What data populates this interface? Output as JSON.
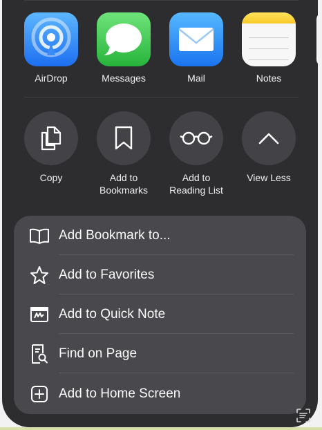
{
  "apps": [
    {
      "name": "airdrop",
      "label": "AirDrop",
      "icon": "airdrop-icon"
    },
    {
      "name": "messages",
      "label": "Messages",
      "icon": "messages-icon"
    },
    {
      "name": "mail",
      "label": "Mail",
      "icon": "mail-icon"
    },
    {
      "name": "notes",
      "label": "Notes",
      "icon": "notes-icon"
    }
  ],
  "actions": [
    {
      "line1": "Copy",
      "line2": "",
      "icon": "copy-icon"
    },
    {
      "line1": "Add to",
      "line2": "Bookmarks",
      "icon": "bookmark-icon"
    },
    {
      "line1": "Add to",
      "line2": "Reading List",
      "icon": "glasses-icon"
    },
    {
      "line1": "View Less",
      "line2": "",
      "icon": "chevron-up-icon"
    }
  ],
  "menu": [
    {
      "label": "Add Bookmark to...",
      "icon": "book-icon"
    },
    {
      "label": "Add to Favorites",
      "icon": "star-icon"
    },
    {
      "label": "Add to Quick Note",
      "icon": "quick-note-icon"
    },
    {
      "label": "Find on Page",
      "icon": "find-on-page-icon"
    },
    {
      "label": "Add to Home Screen",
      "icon": "add-square-icon"
    }
  ],
  "colors": {
    "sheet": "#2d2d30",
    "panel": "#49494d",
    "action_circle": "#434347"
  }
}
